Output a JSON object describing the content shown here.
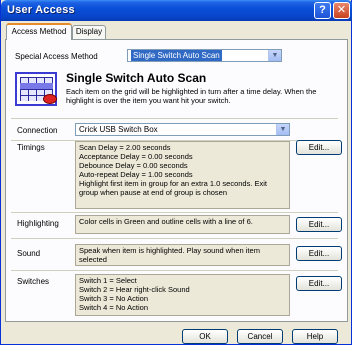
{
  "window": {
    "title": "User Access",
    "help_glyph": "?",
    "close_glyph": "✕"
  },
  "tabs": [
    {
      "label": "Access Method",
      "active": true
    },
    {
      "label": "Display",
      "active": false
    }
  ],
  "access_method": {
    "label": "Special Access Method",
    "selected": "Single Switch Auto Scan",
    "heading": "Single Switch Auto Scan",
    "description": "Each item on the grid will be highlighted in turn after a time delay. When the highlight is over the item you want hit your switch."
  },
  "connection": {
    "label": "Connection",
    "selected": "Crick USB Switch Box"
  },
  "sections": {
    "timings": {
      "label": "Timings",
      "lines": [
        "Scan Delay = 2.00 seconds",
        "Acceptance Delay = 0.00 seconds",
        "Debounce Delay = 0.00 seconds",
        "Auto-repeat Delay = 1.00 seconds",
        "Highlight first item in group for an extra 1.0 seconds. Exit group when pause at end of group is chosen"
      ],
      "edit_label": "Edit..."
    },
    "highlighting": {
      "label": "Highlighting",
      "text": "Color cells in Green and outline cells with a line of 6.",
      "edit_label": "Edit..."
    },
    "sound": {
      "label": "Sound",
      "text": "Speak when item is highlighted. Play sound when item selected",
      "edit_label": "Edit..."
    },
    "switches": {
      "label": "Switches",
      "lines": [
        "Switch 1 = Select",
        "Switch 2 = Hear right-click Sound",
        "Switch 3 = No Action",
        "Switch 4 = No Action"
      ],
      "edit_label": "Edit..."
    }
  },
  "buttons": {
    "ok": "OK",
    "cancel": "Cancel",
    "help": "Help"
  }
}
